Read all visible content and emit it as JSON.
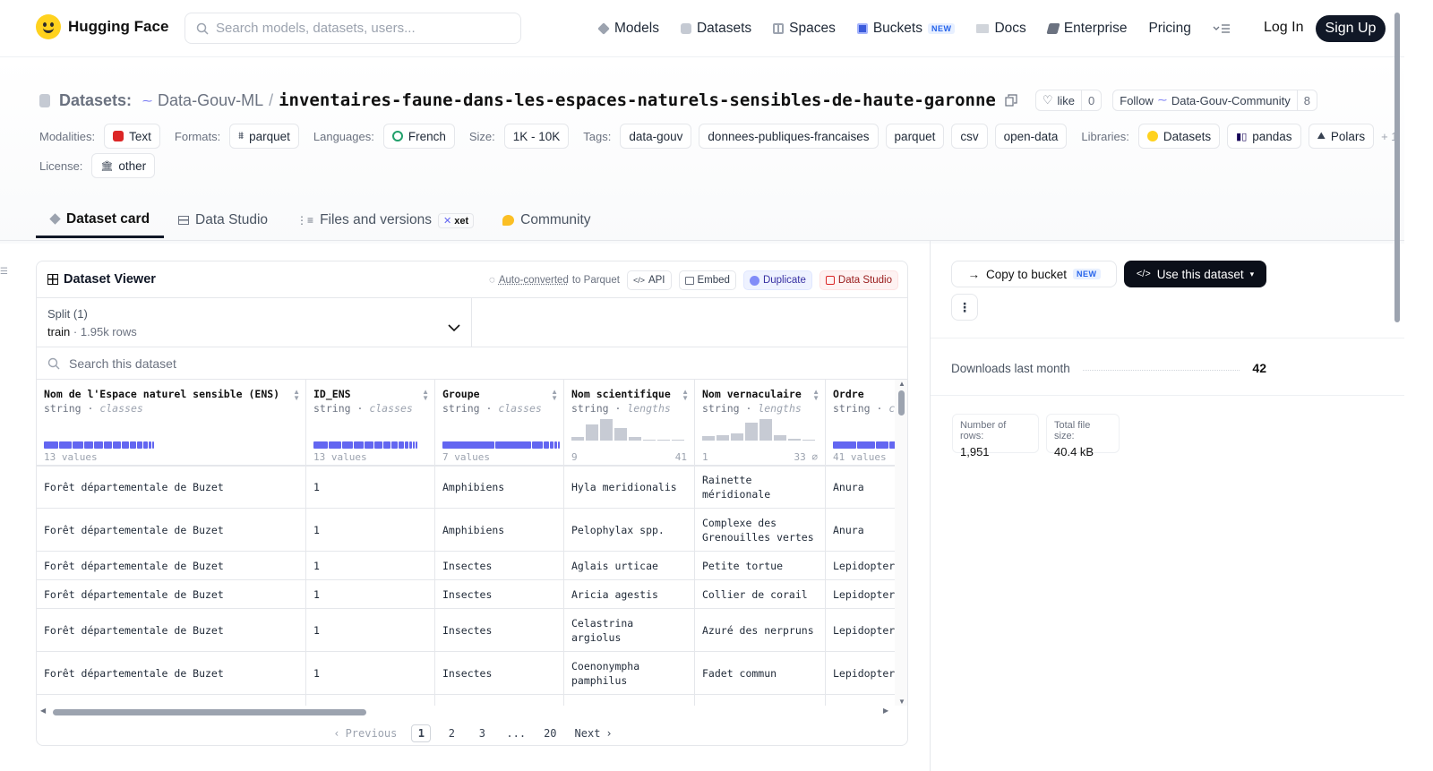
{
  "header": {
    "brand": "Hugging Face",
    "search_placeholder": "Search models, datasets, users...",
    "nav": [
      {
        "label": "Models",
        "icon": "models-icon",
        "color": "#9ca3af"
      },
      {
        "label": "Datasets",
        "icon": "datasets-icon",
        "color": "#b0b7c3"
      },
      {
        "label": "Spaces",
        "icon": "spaces-icon",
        "color": "#9ca3af"
      },
      {
        "label": "Buckets",
        "icon": "buckets-icon",
        "color": "#3b5bdb",
        "badge": "NEW"
      },
      {
        "label": "Docs",
        "icon": "docs-icon",
        "color": "#9ca3af"
      },
      {
        "label": "Enterprise",
        "icon": "enterprise-icon",
        "color": "#6b7280"
      },
      {
        "label": "Pricing"
      }
    ],
    "login": "Log In",
    "signup": "Sign Up"
  },
  "dataset": {
    "prefix": "Datasets:",
    "owner": "Data-Gouv-ML",
    "separator": "/",
    "name": "inventaires-faune-dans-les-espaces-naturels-sensibles-de-haute-garonne",
    "like_label": "like",
    "like_count": "0",
    "follow_label": "Follow",
    "follow_org": "Data-Gouv-Community",
    "follow_count": "8"
  },
  "meta": {
    "modalities_label": "Modalities:",
    "modality": "Text",
    "formats_label": "Formats:",
    "format": "parquet",
    "languages_label": "Languages:",
    "language": "French",
    "size_label": "Size:",
    "size": "1K - 10K",
    "tags_label": "Tags:",
    "tags": [
      "data-gouv",
      "donnees-publiques-francaises",
      "parquet",
      "csv",
      "open-data"
    ],
    "libraries_label": "Libraries:",
    "libraries": [
      "Datasets",
      "pandas",
      "Polars"
    ],
    "libraries_more": "+ 1",
    "license_label": "License:",
    "license": "other"
  },
  "tabs": [
    {
      "label": "Dataset card",
      "active": true
    },
    {
      "label": "Data Studio"
    },
    {
      "label": "Files and versions",
      "badge": "xet"
    },
    {
      "label": "Community"
    }
  ],
  "sidebar": {
    "copy_label": "Copy to bucket",
    "copy_badge": "NEW",
    "use_label": "Use this dataset",
    "downloads_label": "Downloads last month",
    "downloads": "42",
    "rows_label": "Number of rows:",
    "rows": "1,951",
    "size_label": "Total file size:",
    "size": "40.4 kB"
  },
  "viewer": {
    "title": "Dataset Viewer",
    "autoconv": "Auto-converted",
    "autoconv_suffix": "to Parquet",
    "api": "API",
    "embed": "Embed",
    "duplicate": "Duplicate",
    "studio": "Data Studio",
    "split_label": "Split (1)",
    "split_name": "train",
    "split_rows": "1.95k rows",
    "search_placeholder": "Search this dataset",
    "columns": [
      {
        "name": "Nom de l'Espace naturel sensible (ENS)",
        "type": "string",
        "kind": "classes",
        "foot": "13 values"
      },
      {
        "name": "ID_ENS",
        "type": "string",
        "kind": "classes",
        "foot": "13 values"
      },
      {
        "name": "Groupe",
        "type": "string",
        "kind": "classes",
        "foot": "7 values"
      },
      {
        "name": "Nom scientifique",
        "type": "string",
        "kind": "lengths",
        "min": "9",
        "max": "41"
      },
      {
        "name": "Nom vernaculaire",
        "type": "string",
        "kind": "lengths",
        "min": "1",
        "max": "33 ⌀"
      },
      {
        "name": "Ordre",
        "type": "string",
        "kind": "cl",
        "foot": "41 values"
      }
    ],
    "rows": [
      [
        "Forêt départementale de Buzet",
        "1",
        "Amphibiens",
        "Hyla meridionalis",
        "Rainette méridionale",
        "Anura"
      ],
      [
        "Forêt départementale de Buzet",
        "1",
        "Amphibiens",
        "Pelophylax spp.",
        "Complexe des Grenouilles vertes",
        "Anura"
      ],
      [
        "Forêt départementale de Buzet",
        "1",
        "Insectes",
        "Aglais urticae",
        "Petite tortue",
        "Lepidopter"
      ],
      [
        "Forêt départementale de Buzet",
        "1",
        "Insectes",
        "Aricia agestis",
        "Collier de corail",
        "Lepidopter"
      ],
      [
        "Forêt départementale de Buzet",
        "1",
        "Insectes",
        "Celastrina argiolus",
        "Azuré des nerpruns",
        "Lepidopter"
      ],
      [
        "Forêt départementale de Buzet",
        "1",
        "Insectes",
        "Coenonympha pamphilus",
        "Fadet commun",
        "Lepidopter"
      ]
    ],
    "pager": {
      "prev": "Previous",
      "pages": [
        "1",
        "2",
        "3",
        "...",
        "20"
      ],
      "next": "Next"
    }
  }
}
